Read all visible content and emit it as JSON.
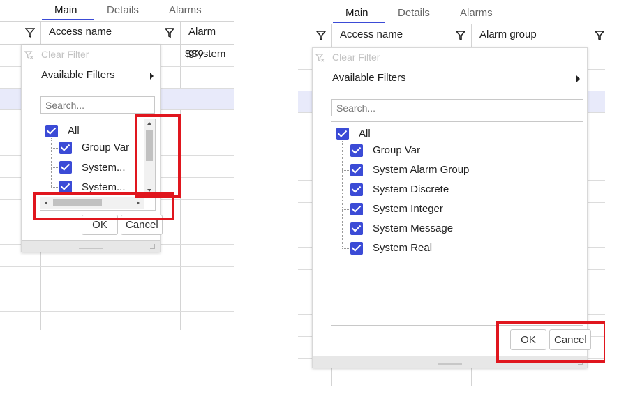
{
  "tabs": [
    "Main",
    "Details",
    "Alarms"
  ],
  "columns": {
    "access_name": "Access name",
    "alarm_group_cut": "Alarm gro",
    "alarm_group": "Alarm group"
  },
  "grid": {
    "first_cell": "$System"
  },
  "filter": {
    "clear_filter": "Clear Filter",
    "available_filters": "Available Filters",
    "search_placeholder": "Search...",
    "all_label": "All",
    "items_truncated": [
      "Group Var",
      "System...",
      "System..."
    ],
    "items": [
      "Group Var",
      "System Alarm Group",
      "System Discrete",
      "System Integer",
      "System Message",
      "System Real"
    ],
    "ok": "OK",
    "cancel": "Cancel"
  },
  "colors": {
    "accent": "#3b4bd6",
    "highlight": "#e0161e",
    "selected_row": "#e8eafa"
  },
  "icons": [
    "filter-icon",
    "clear-filter-icon",
    "chevron-right-icon",
    "checkbox-checked-icon"
  ]
}
